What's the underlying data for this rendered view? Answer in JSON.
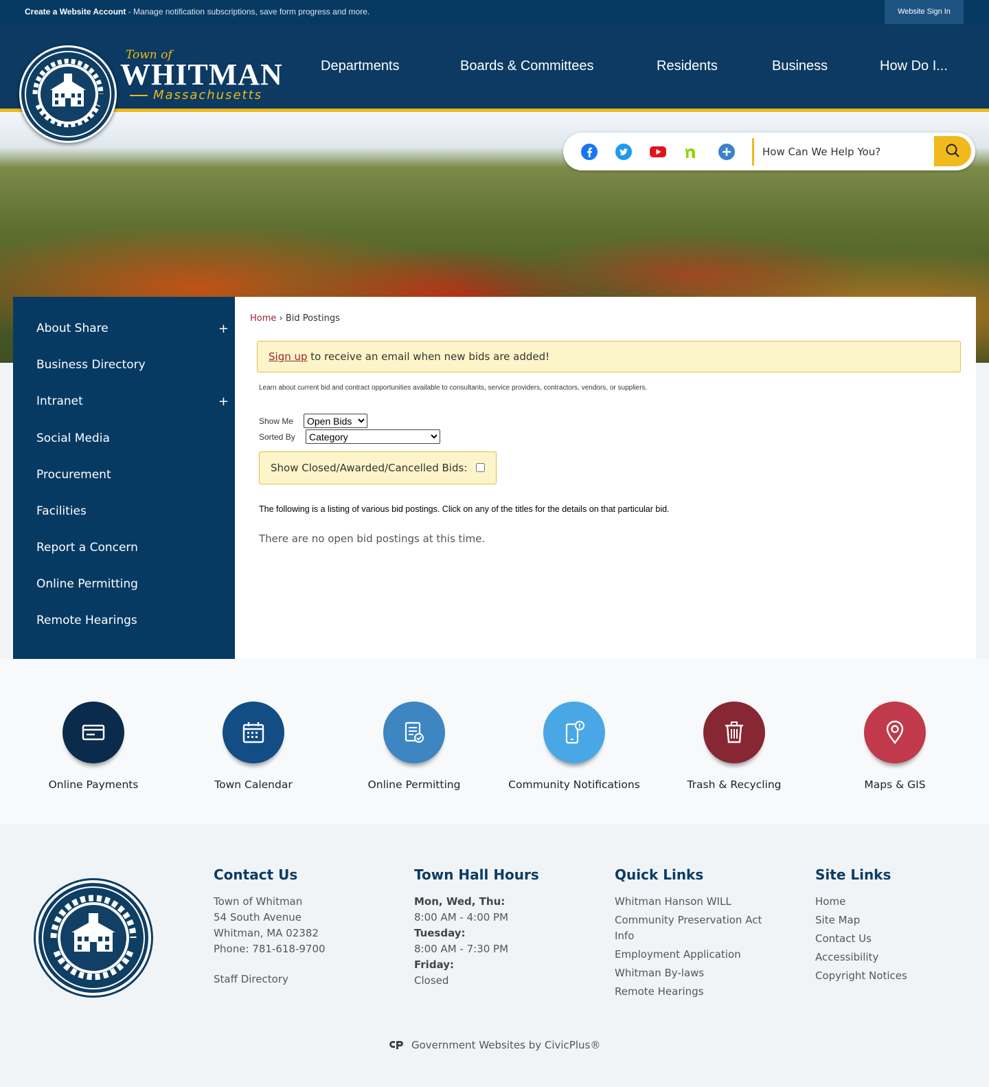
{
  "topbar": {
    "create_label": "Create a Website Account",
    "create_desc": " - Manage notification subscriptions, save form progress and more.",
    "signin_label": "Website Sign In"
  },
  "logo": {
    "town_of": "Town of",
    "name": "WHITMAN",
    "state": "Massachusetts"
  },
  "nav": {
    "items": [
      "Departments",
      "Boards & Committees",
      "Residents",
      "Business",
      "How Do I..."
    ]
  },
  "search": {
    "placeholder": "How Can We Help You?",
    "social_icons": [
      "facebook-icon",
      "twitter-icon",
      "youtube-icon",
      "nextdoor-icon",
      "more-icon"
    ]
  },
  "sidebar": {
    "items": [
      {
        "label": "About Share",
        "expand": "+"
      },
      {
        "label": "Business Directory",
        "expand": ""
      },
      {
        "label": "Intranet",
        "expand": "+"
      },
      {
        "label": "Social Media",
        "expand": ""
      },
      {
        "label": "Procurement",
        "expand": ""
      },
      {
        "label": "Facilities",
        "expand": ""
      },
      {
        "label": "Report a Concern",
        "expand": ""
      },
      {
        "label": "Online Permitting",
        "expand": ""
      },
      {
        "label": "Remote Hearings",
        "expand": ""
      }
    ]
  },
  "content": {
    "breadcrumb_home": "Home",
    "breadcrumb_sep": " › ",
    "breadcrumb_current": "Bid Postings",
    "alert_link": "Sign up",
    "alert_text": " to receive an email when new bids are added!",
    "learn_text": "Learn about current bid and contract opportunities available to consultants, service providers, contractors, vendors, or suppliers.",
    "show_me_label": "Show Me",
    "show_me_value": "Open Bids",
    "sorted_by_label": "Sorted By",
    "sorted_by_value": "Category",
    "closed_label": "Show Closed/Awarded/Cancelled Bids:",
    "listing_text": "The following is a listing of various bid postings. Click on any of the titles for the details on that particular bid.",
    "no_bids_text": "There are no open bid postings at this time."
  },
  "quick_links": [
    {
      "label": "Online Payments",
      "color": "#0b2b4c",
      "icon": "payment-card-icon"
    },
    {
      "label": "Town Calendar",
      "color": "#124d85",
      "icon": "calendar-icon"
    },
    {
      "label": "Online Permitting",
      "color": "#3d86c2",
      "icon": "clipboard-check-icon"
    },
    {
      "label": "Community Notifications",
      "color": "#4aa7e5",
      "icon": "mobile-alert-icon"
    },
    {
      "label": "Trash & Recycling",
      "color": "#872734",
      "icon": "trash-icon"
    },
    {
      "label": "Maps & GIS",
      "color": "#c03a4b",
      "icon": "map-pin-icon"
    }
  ],
  "footer": {
    "contact": {
      "title": "Contact Us",
      "lines": [
        "Town of Whitman",
        "54 South Avenue",
        "Whitman, MA 02382",
        "Phone: 781-618-9700"
      ],
      "staff_link": "Staff Directory"
    },
    "hours": {
      "title": "Town Hall Hours",
      "rows": [
        {
          "day": "Mon, Wed, Thu:",
          "time": "8:00 AM - 4:00 PM"
        },
        {
          "day": "Tuesday:",
          "time": "8:00 AM - 7:30 PM"
        },
        {
          "day": "Friday:",
          "time": "Closed"
        }
      ]
    },
    "quick": {
      "title": "Quick Links",
      "links": [
        "Whitman Hanson WILL",
        "Community Preservation Act Info",
        "Employment Application",
        "Whitman By-laws",
        "Remote Hearings"
      ]
    },
    "site": {
      "title": "Site Links",
      "links": [
        "Home",
        "Site Map",
        "Contact Us",
        "Accessibility",
        "Copyright Notices"
      ]
    },
    "credit": "Government Websites by CivicPlus®"
  },
  "colors": {
    "navy": "#073a63",
    "gold": "#f0b91c",
    "link_red": "#9b2535"
  }
}
